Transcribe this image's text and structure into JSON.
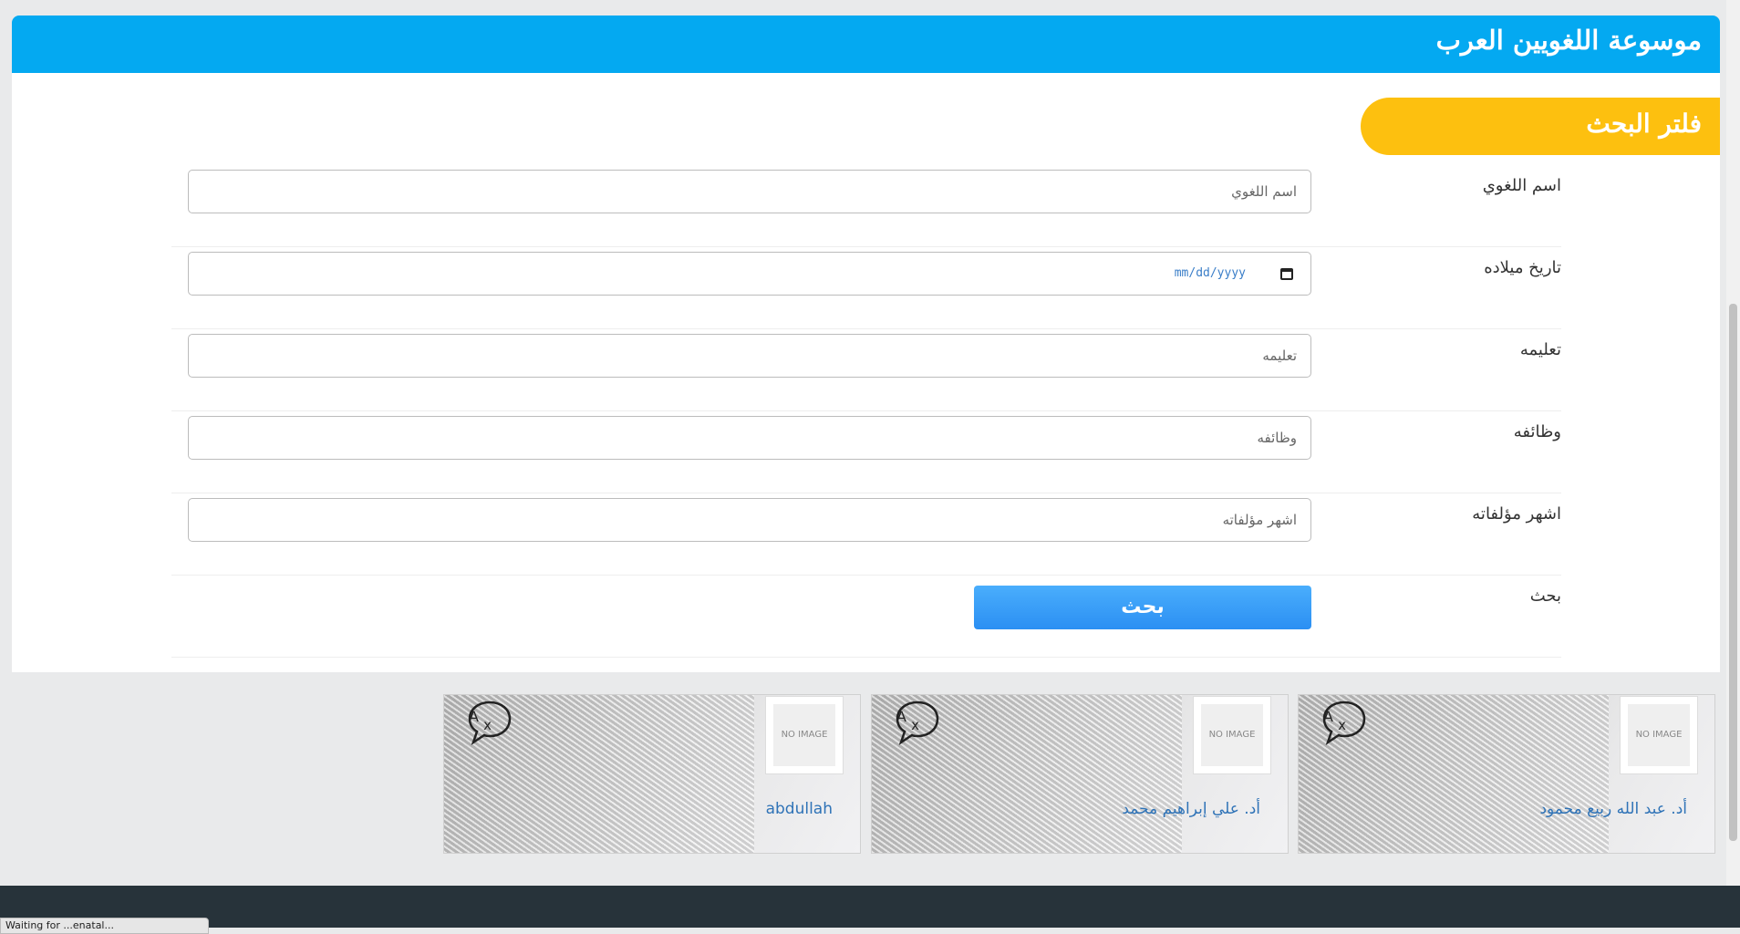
{
  "header": {
    "title": "موسوعة اللغويين العرب"
  },
  "filter": {
    "title": "فلتر البحث",
    "rows": [
      {
        "label": "اسم اللغوي",
        "placeholder": "اسم اللغوي"
      },
      {
        "label": "تاريخ ميلاده",
        "placeholder": "mm/dd/yyyy"
      },
      {
        "label": "تعليمه",
        "placeholder": "تعليمه"
      },
      {
        "label": "وظائفه",
        "placeholder": "وظائفه"
      },
      {
        "label": "اشهر مؤلفاته",
        "placeholder": "اشهر مؤلفاته"
      }
    ],
    "search_label": "بحث",
    "search_button": "بحث"
  },
  "cards": [
    {
      "name": "أد. عبد الله ربيع محمود",
      "image_text": "NO IMAGE"
    },
    {
      "name": "أد. علي إبراهيم محمد",
      "image_text": "NO IMAGE"
    },
    {
      "name": "abdullah",
      "image_text": "NO IMAGE"
    }
  ],
  "icons": {
    "card_icon": "translate-icon",
    "date_icon": "calendar-icon"
  },
  "colors": {
    "header": "#04a9f1",
    "filter_pill": "#fdc00f",
    "button": "#2b8ff3",
    "footer": "#27333a"
  },
  "status_bar": {
    "text": "Waiting for ...enatal..."
  }
}
